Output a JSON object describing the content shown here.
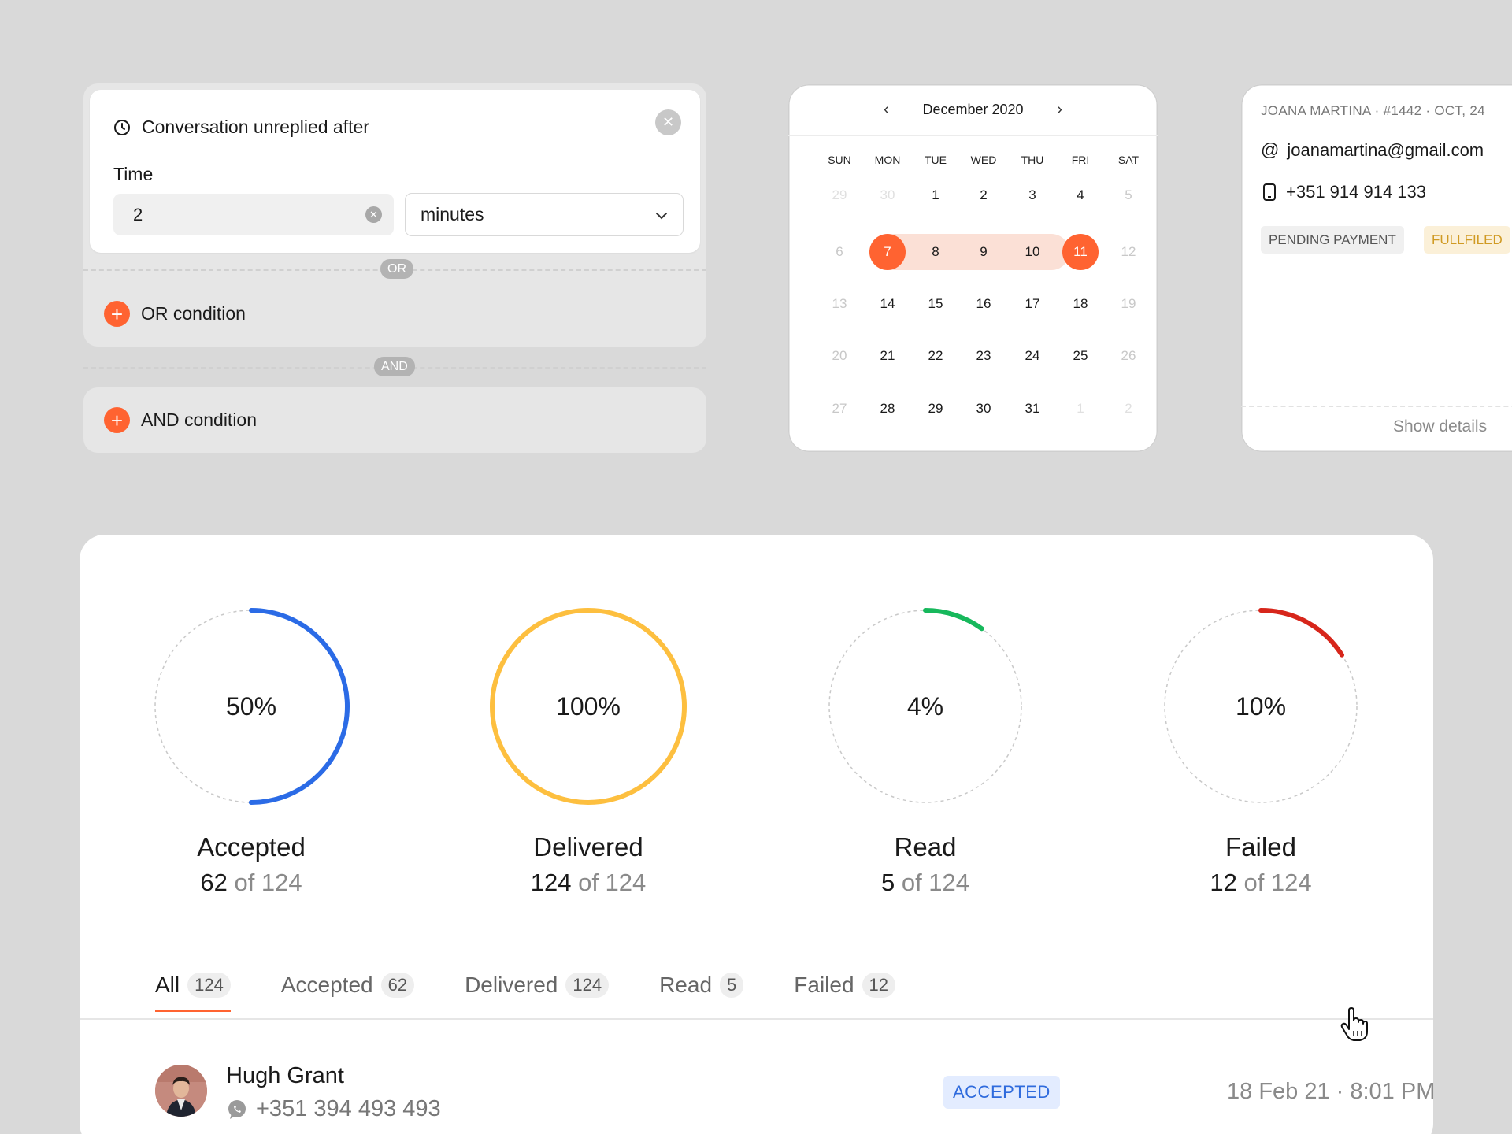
{
  "condition": {
    "title": "Conversation unreplied after",
    "time_label": "Time",
    "time_value": "2",
    "unit": "minutes",
    "or_pill": "OR",
    "or_add": "OR condition",
    "and_pill": "AND",
    "and_add": "AND condition"
  },
  "calendar": {
    "month": "December 2020",
    "weekdays": [
      "SUN",
      "MON",
      "TUE",
      "WED",
      "THU",
      "FRI",
      "SAT"
    ],
    "weeks": [
      [
        "29",
        "30",
        "1",
        "2",
        "3",
        "4",
        "5"
      ],
      [
        "6",
        "7",
        "8",
        "9",
        "10",
        "11",
        "12"
      ],
      [
        "13",
        "14",
        "15",
        "16",
        "17",
        "18",
        "19"
      ],
      [
        "20",
        "21",
        "22",
        "23",
        "24",
        "25",
        "26"
      ],
      [
        "27",
        "28",
        "29",
        "30",
        "31",
        "1",
        "2"
      ]
    ],
    "range_start": "7",
    "range_end": "11",
    "accent_color": "#ff6331"
  },
  "contact": {
    "meta": "JOANA MARTINA · #1442 · OCT, 24",
    "email": "joanamartina@gmail.com",
    "phone": "+351 914 914 133",
    "tags": [
      "PENDING PAYMENT",
      "FULLFILED"
    ],
    "show_details": "Show details"
  },
  "stats": [
    {
      "percent_label": "50%",
      "name": "Accepted",
      "count": "62",
      "of": "of 124",
      "fraction": 0.5,
      "color": "#2b6be6"
    },
    {
      "percent_label": "100%",
      "name": "Delivered",
      "count": "124",
      "of": "of 124",
      "fraction": 1.0,
      "color": "#fdbf3f"
    },
    {
      "percent_label": "4%",
      "name": "Read",
      "count": "5",
      "of": "of 124",
      "fraction": 0.1,
      "color": "#17b85c"
    },
    {
      "percent_label": "10%",
      "name": "Failed",
      "count": "12",
      "of": "of 124",
      "fraction": 0.16,
      "color": "#d7261b"
    }
  ],
  "tabs": [
    {
      "label": "All",
      "count": "124"
    },
    {
      "label": "Accepted",
      "count": "62"
    },
    {
      "label": "Delivered",
      "count": "124"
    },
    {
      "label": "Read",
      "count": "5"
    },
    {
      "label": "Failed",
      "count": "12"
    }
  ],
  "rows": [
    {
      "name": "Hugh Grant",
      "phone": "+351 394 493 493",
      "status": "ACCEPTED",
      "date": "18 Feb 21 · 8:01 PM"
    }
  ]
}
